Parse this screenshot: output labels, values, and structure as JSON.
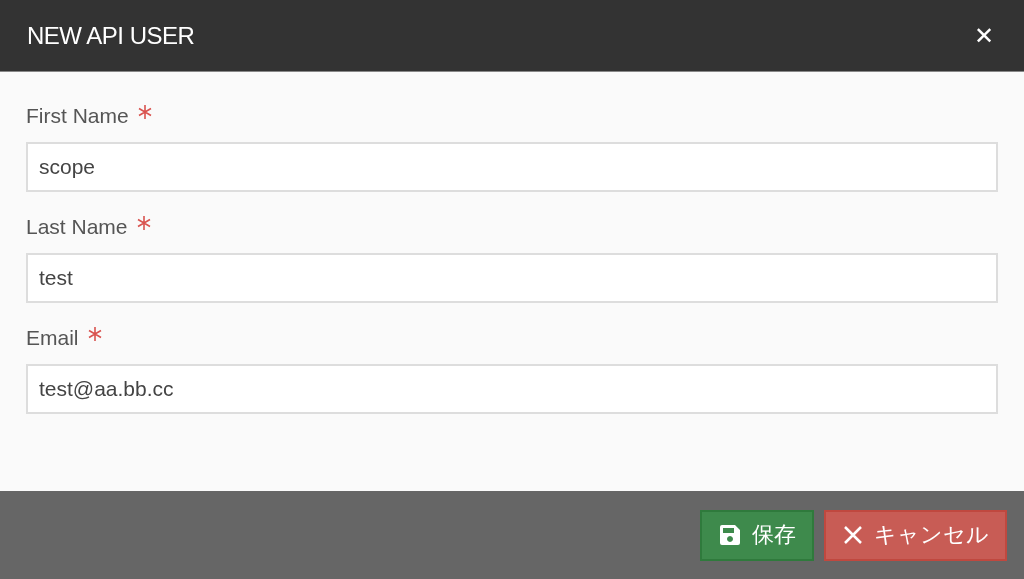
{
  "dialog": {
    "title": "NEW API USER",
    "close": "✕"
  },
  "fields": [
    {
      "label": "First Name",
      "required": true,
      "value": "scope"
    },
    {
      "label": "Last Name",
      "required": true,
      "value": "test"
    },
    {
      "label": "Email",
      "required": true,
      "value": "test@aa.bb.cc"
    }
  ],
  "buttons": [
    {
      "kind": "save",
      "label": "保存"
    },
    {
      "kind": "cancel",
      "label": "キャンセル"
    }
  ]
}
